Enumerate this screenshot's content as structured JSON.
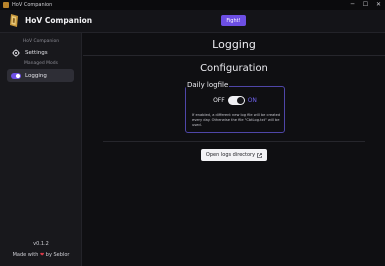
{
  "window": {
    "title": "HoV Companion",
    "controls": {
      "minimize": "─",
      "maximize": "☐",
      "close": "✕"
    }
  },
  "header": {
    "app_name": "HoV Companion",
    "fight_label": "Fight!",
    "accent_color": "#6d4fe4"
  },
  "sidebar": {
    "sections": [
      {
        "label": "HoV Companion",
        "items": [
          {
            "label": "Settings",
            "icon": "gear-icon",
            "active": false
          }
        ]
      },
      {
        "label": "Managed Mods",
        "items": [
          {
            "label": "Logging",
            "icon": "toggle-icon",
            "active": true
          }
        ]
      }
    ],
    "version": "v0.1.2",
    "footer": {
      "made_with": "Made with",
      "heart": "❤",
      "by": "by Seblor"
    }
  },
  "main": {
    "page_title": "Logging",
    "section_title": "Configuration",
    "daily_logfile": {
      "title": "Daily logfile",
      "off_label": "OFF",
      "on_label": "ON",
      "value": true,
      "description": "If enabled, a different new log file will be created every day. Otherwise the file \"CbtLog.txt\" will be used."
    },
    "open_logs_label": "Open logs directory",
    "open_logs_icon": "external-link-icon"
  }
}
